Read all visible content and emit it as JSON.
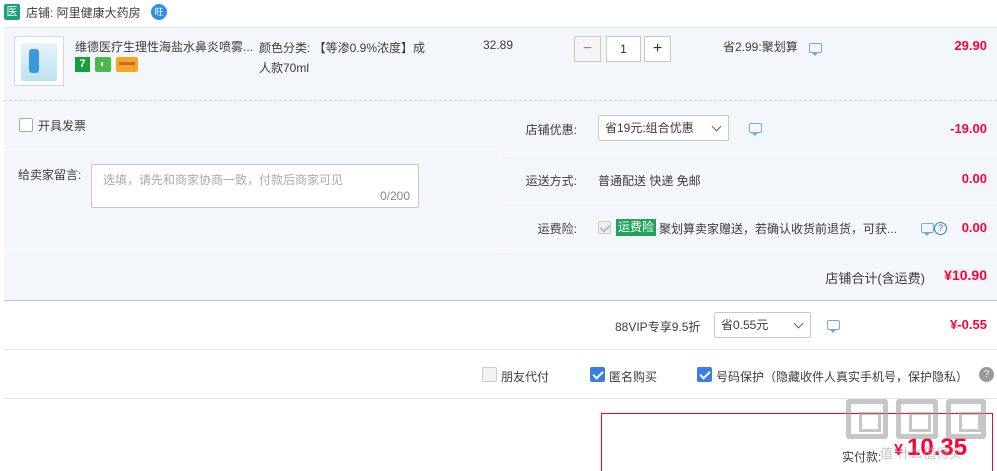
{
  "store": {
    "badge": "医",
    "name": "店铺: 阿里健康大药房",
    "wangwang": "旺"
  },
  "item": {
    "title": "维德医疗生理性海盐水鼻炎喷雾...",
    "tag_seven": "7",
    "tag_green": "◐",
    "sku_line1": "颜色分类: 【等渗0.9%浓度】成",
    "sku_line2": "人款70ml",
    "unit_price": "32.89",
    "qty_minus": "−",
    "qty_value": "1",
    "qty_plus": "+",
    "promo": "省2.99:聚划算",
    "total": "29.90"
  },
  "options": {
    "invoice_label": "开具发票",
    "memo_label": "给卖家留言:",
    "memo_placeholder": "选填，请先和商家协商一致，付款后商家可见",
    "memo_count": "0/200",
    "store_discount_label": "店铺优惠:",
    "store_discount_value": "省19元:组合优惠",
    "store_discount_amount": "-19.00",
    "shipping_label": "运送方式:",
    "shipping_value": "普通配送 快递 免邮",
    "shipping_amount": "0.00",
    "insurance_label": "运费险:",
    "insurance_tag": "运费险",
    "insurance_text": "聚划算卖家赠送，若确认收货前退货，可获...",
    "insurance_help": "?",
    "insurance_amount": "0.00"
  },
  "store_total": {
    "label": "店铺合计(含运费)",
    "amount": "¥10.90"
  },
  "vip": {
    "label": "88VIP专享9.5折",
    "select_value": "省0.55元",
    "amount": "¥-0.55"
  },
  "checkout_options": {
    "friend_pay": "朋友代付",
    "anonymous": "匿名购买",
    "number_protect": "号码保护（隐藏收件人真实手机号，保护隐私）",
    "help": "?"
  },
  "payment": {
    "label": "实付款:",
    "currency": "¥",
    "amount": "10.35"
  },
  "watermark": {
    "text": "值 什么值得买"
  }
}
